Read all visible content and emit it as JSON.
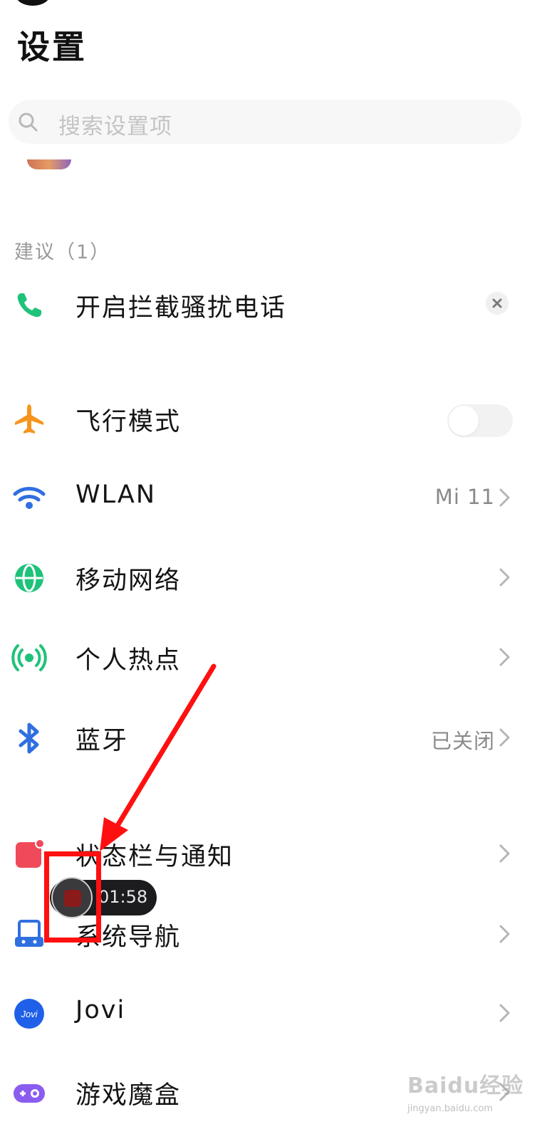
{
  "page_title": "设置",
  "search": {
    "placeholder": "搜索设置项"
  },
  "suggestions": {
    "header": "建议（1）",
    "item": {
      "label": "开启拦截骚扰电话",
      "icon": "phone-icon"
    }
  },
  "settings": {
    "airplane": {
      "label": "飞行模式",
      "icon": "airplane-icon",
      "toggle_on": false
    },
    "wlan": {
      "label": "WLAN",
      "value": "Mi 11",
      "icon": "wifi-icon"
    },
    "mobile_network": {
      "label": "移动网络",
      "icon": "globe-icon"
    },
    "hotspot": {
      "label": "个人热点",
      "icon": "hotspot-icon"
    },
    "bluetooth": {
      "label": "蓝牙",
      "value": "已关闭",
      "icon": "bluetooth-icon"
    },
    "status_bar": {
      "label": "状态栏与通知",
      "icon": "notification-icon"
    },
    "system_nav": {
      "label": "系统导航",
      "icon": "navigation-icon"
    },
    "jovi": {
      "label": "Jovi",
      "icon": "jovi-icon",
      "icon_text": "Jovi"
    },
    "game_box": {
      "label": "游戏魔盒",
      "icon": "gamepad-icon"
    }
  },
  "screen_recorder": {
    "time": "01:58"
  },
  "watermark": {
    "title": "Baidu经验",
    "url": "jingyan.baidu.com"
  },
  "colors": {
    "phone": "#1fc27a",
    "airplane": "#f7941d",
    "wifi": "#2f6fe0",
    "globe": "#1fc27a",
    "hotspot": "#1fc27a",
    "bluetooth": "#2f6fe0",
    "notification": "#f04a5a",
    "navigation": "#2f6fe0",
    "jovi": "#2060e8",
    "gamepad": "#8a5cf0",
    "annotation": "#ff1010"
  }
}
